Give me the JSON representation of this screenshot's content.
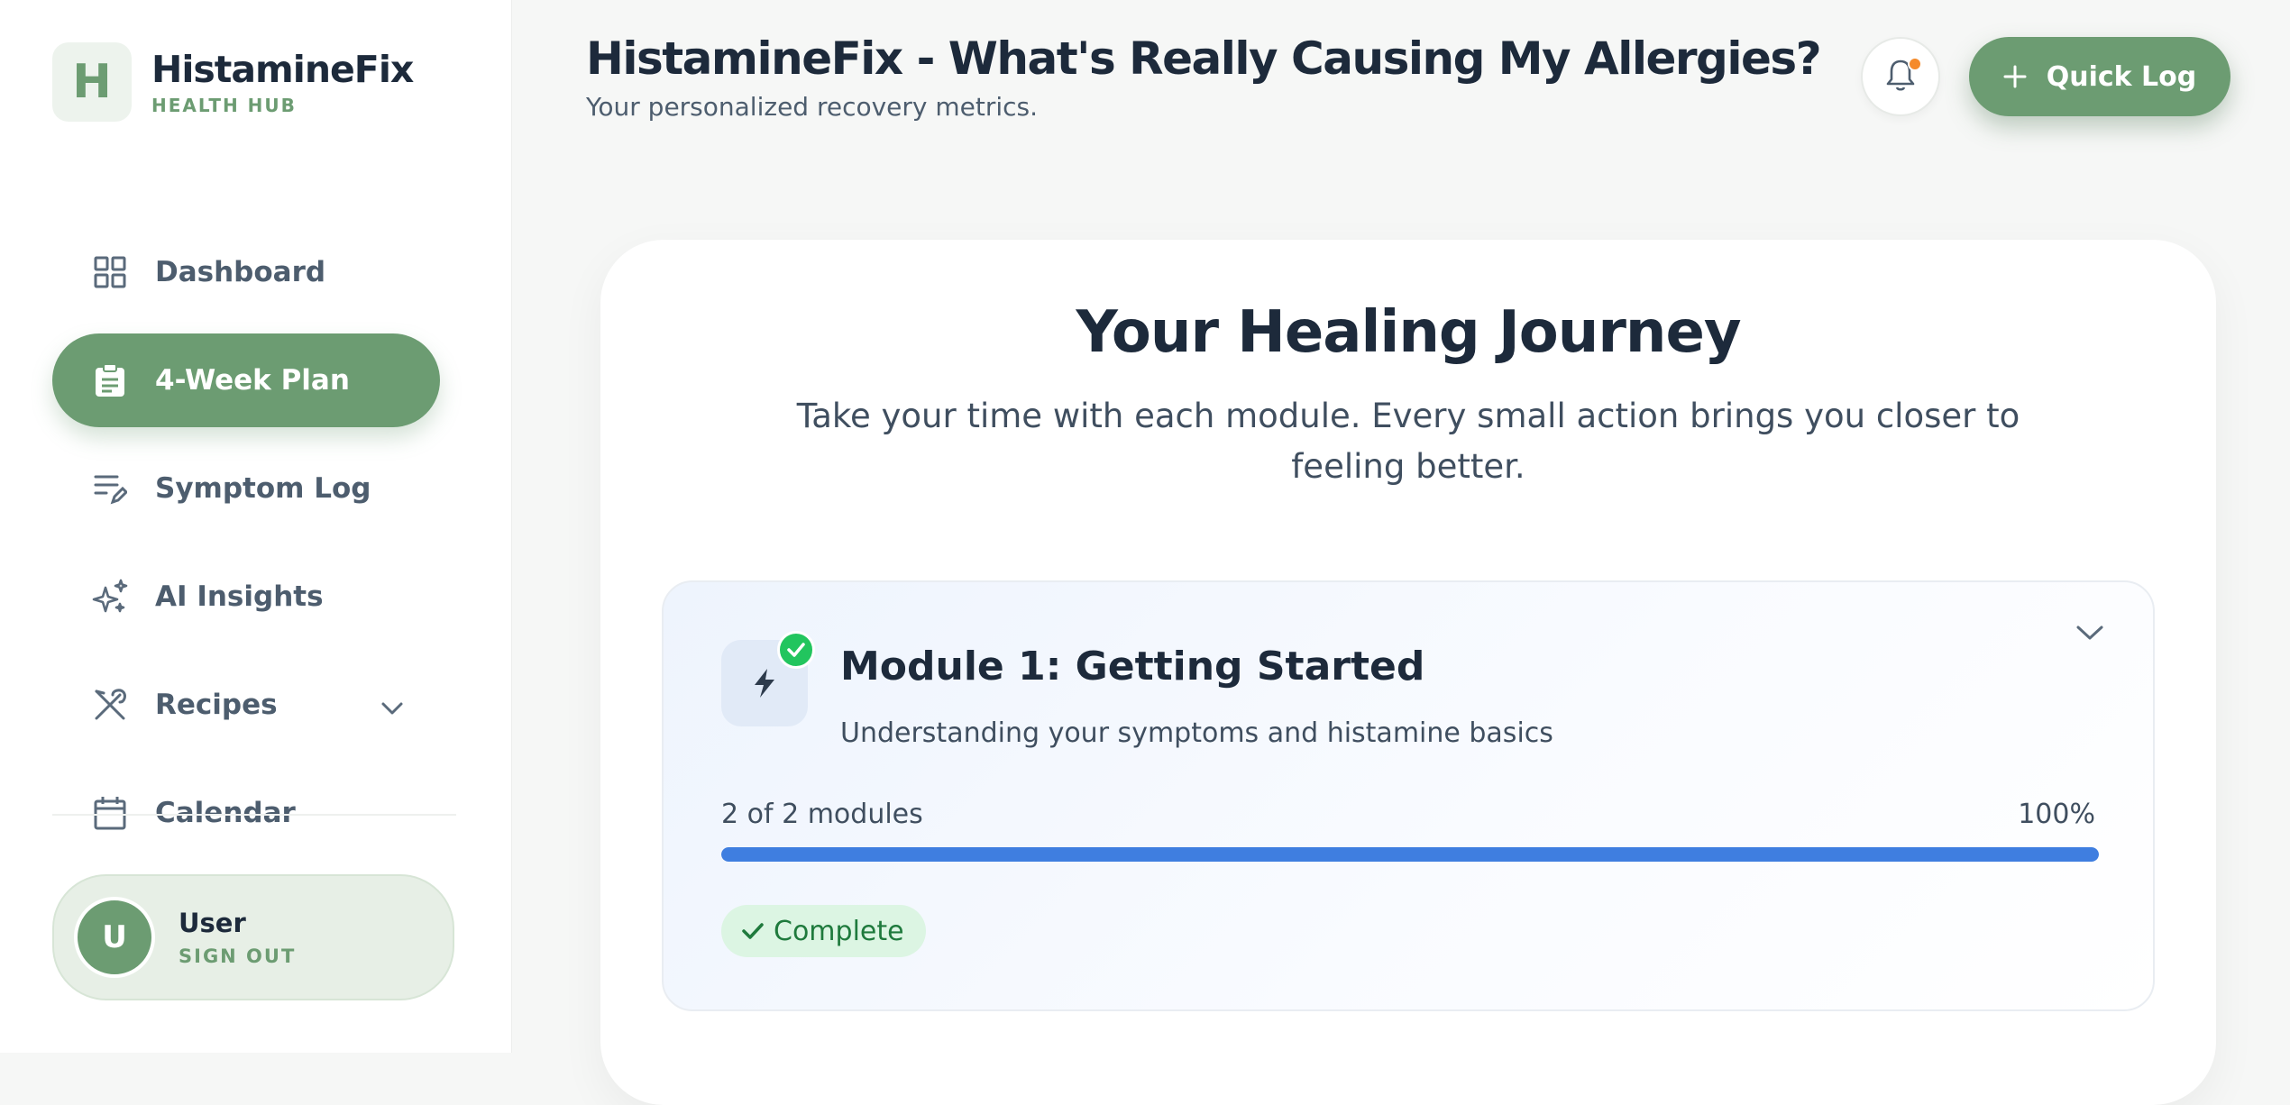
{
  "brand": {
    "logo_letter": "H",
    "name": "HistamineFix",
    "subtitle": "HEALTH HUB"
  },
  "sidebar": {
    "items": [
      {
        "label": "Dashboard",
        "icon": "grid-icon"
      },
      {
        "label": "4-Week Plan",
        "icon": "clipboard-icon",
        "active": true
      },
      {
        "label": "Symptom Log",
        "icon": "list-edit-icon"
      },
      {
        "label": "AI Insights",
        "icon": "sparkles-icon"
      },
      {
        "label": "Recipes",
        "icon": "utensils-icon",
        "has_submenu": true
      },
      {
        "label": "Calendar",
        "icon": "calendar-icon"
      }
    ]
  },
  "user": {
    "initial": "U",
    "name": "User",
    "sign_out": "SIGN OUT"
  },
  "header": {
    "title": "HistamineFix - What's Really Causing My Allergies?",
    "subtitle": "Your personalized recovery metrics.",
    "quick_log": "Quick Log"
  },
  "journey": {
    "title": "Your Healing Journey",
    "subtitle": "Take your time with each module. Every small action brings you closer to feeling better.",
    "modules": [
      {
        "title": "Module 1: Getting Started",
        "description": "Understanding your symptoms and histamine basics",
        "progress_text": "2 of 2 modules",
        "progress_percent": "100%",
        "progress_value": 1.0,
        "status": "Complete",
        "icon": "lightning-icon"
      }
    ]
  },
  "colors": {
    "brand_green": "#6c9c72",
    "progress_blue": "#3f7ee0",
    "success_green": "#22c55e",
    "notification_orange": "#f58a2a"
  }
}
